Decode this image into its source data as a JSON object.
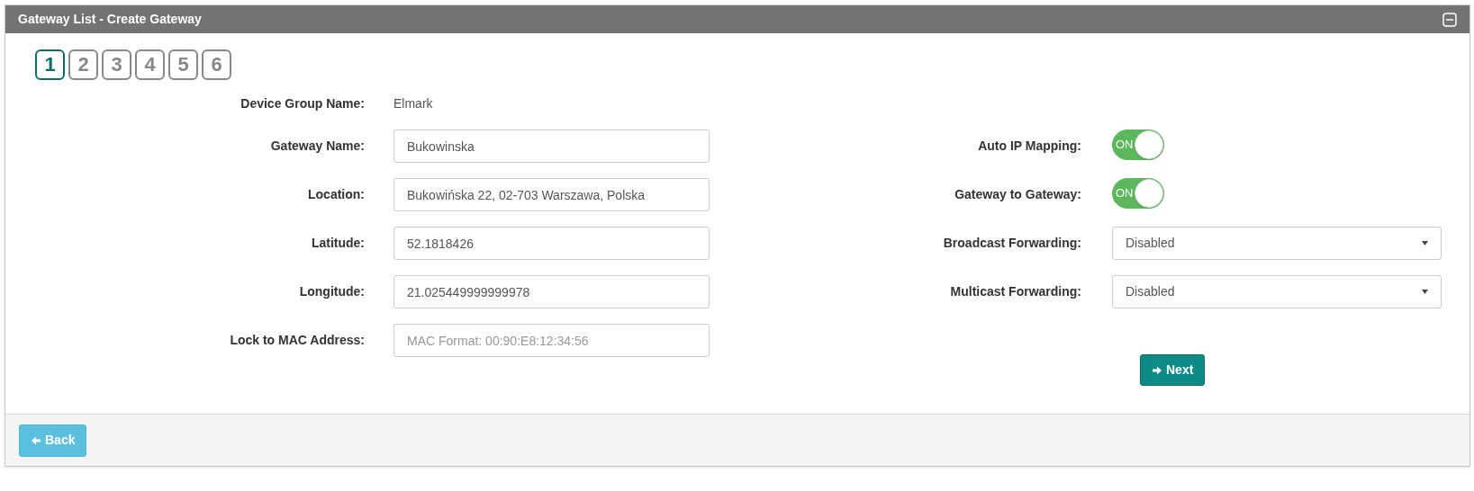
{
  "panel": {
    "title": "Gateway List - Create Gateway",
    "collapsed": false
  },
  "steps": [
    {
      "label": "1",
      "selected": true
    },
    {
      "label": "2",
      "selected": false
    },
    {
      "label": "3",
      "selected": false
    },
    {
      "label": "4",
      "selected": false
    },
    {
      "label": "5",
      "selected": false
    },
    {
      "label": "6",
      "selected": false
    }
  ],
  "device_group": {
    "label": "Device Group Name:",
    "value": "Elmark"
  },
  "left_fields": [
    {
      "label": "Gateway Name:",
      "value": "Bukowinska"
    },
    {
      "label": "Location:",
      "value": "Bukowińska 22, 02-703 Warszawa, Polska"
    },
    {
      "label": "Latitude:",
      "value": "52.1818426"
    },
    {
      "label": "Longitude:",
      "value": "21.025449999999978"
    },
    {
      "label": "Lock to MAC Address:",
      "placeholder": "MAC Format: 00:90:E8:12:34:56"
    }
  ],
  "right_fields": [
    {
      "kind": "toggle",
      "label": "Auto IP Mapping:",
      "on": true,
      "on_text": "ON"
    },
    {
      "kind": "toggle",
      "label": "Gateway to Gateway:",
      "on": true,
      "on_text": "ON"
    },
    {
      "kind": "select",
      "label": "Broadcast Forwarding:",
      "value": "Disabled"
    },
    {
      "kind": "select",
      "label": "Multicast Forwarding:",
      "value": "Disabled"
    }
  ],
  "next_button": "Next",
  "back_button": "Back"
}
